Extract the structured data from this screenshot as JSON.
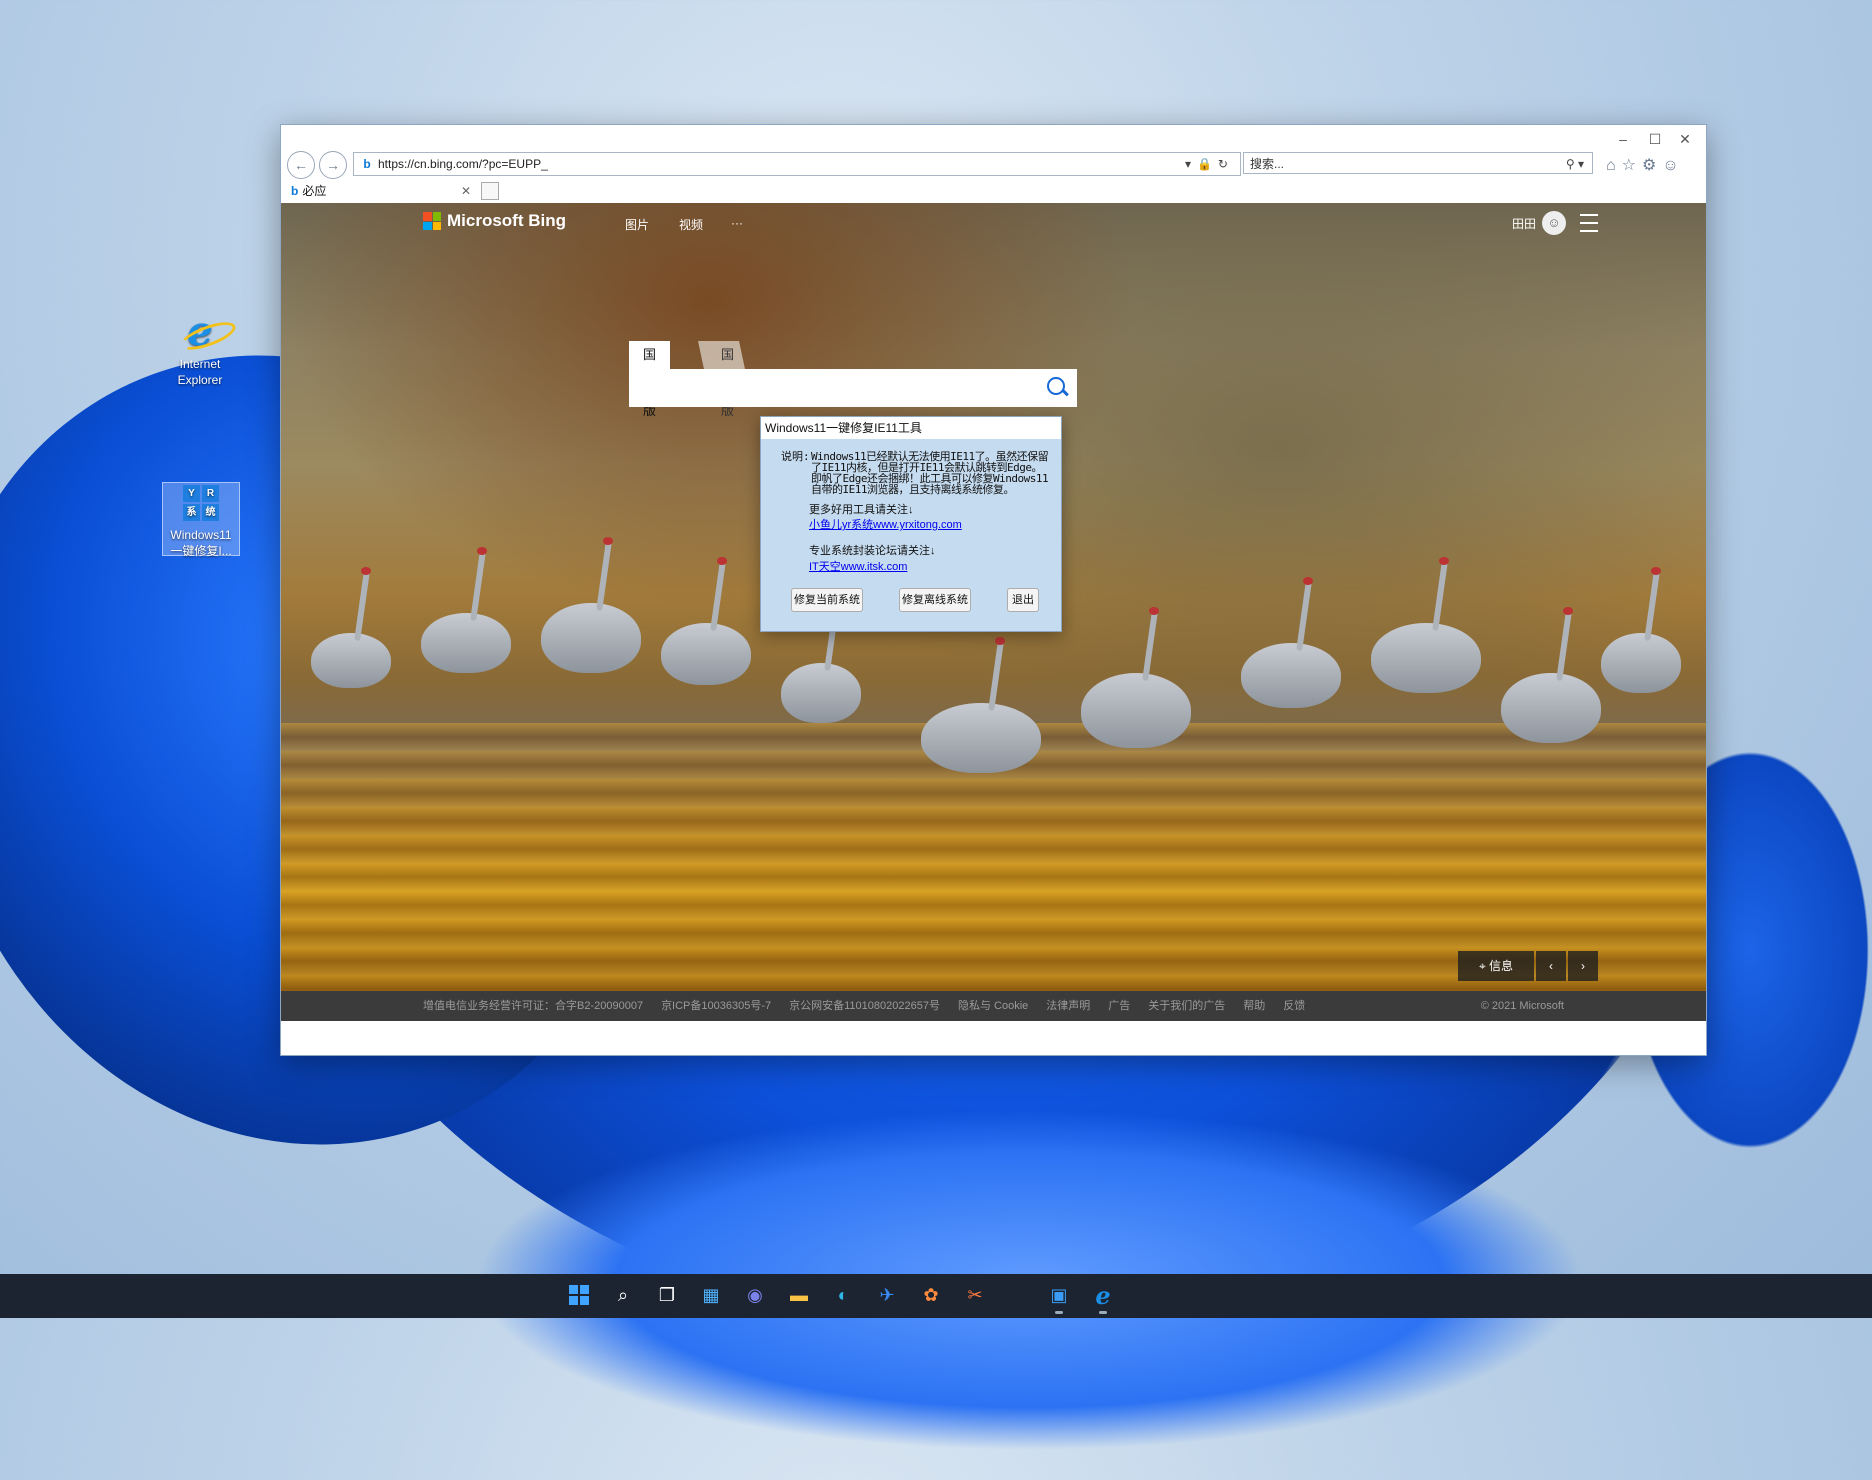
{
  "desktop": {
    "icons": [
      {
        "label_line1": "Internet",
        "label_line2": "Explorer"
      },
      {
        "label_line1": "Windows11",
        "label_line2": "一键修复I..."
      }
    ],
    "tool_icon_glyphs": [
      "Y",
      "R",
      "系",
      "统"
    ]
  },
  "browser": {
    "window_controls": {
      "minimize": "–",
      "maximize": "☐",
      "close": "✕"
    },
    "nav": {
      "back": "←",
      "forward": "→"
    },
    "address": "https://cn.bing.com/?pc=EUPP_",
    "address_tools": "▾🔒↻",
    "search_placeholder": "搜索...",
    "search_icon": "⚲ ▾",
    "right_tools": "⌂☆⚙☺",
    "tab": {
      "title": "必应",
      "close": "✕"
    }
  },
  "bing": {
    "logo_text": "Microsoft Bing",
    "nav": [
      "图片",
      "视频",
      "···"
    ],
    "user_name": "田田",
    "search_tabs": [
      "国内版",
      "国际版"
    ],
    "info_button": "信息",
    "prev": "‹",
    "next": "›",
    "footer_links": [
      "增值电信业务经营许可证：合字B2-20090007",
      "京ICP备10036305号-7",
      "京公网安备11010802022657号",
      "隐私与 Cookie",
      "法律声明",
      "广告",
      "关于我们的广告",
      "帮助",
      "反馈"
    ],
    "copyright": "© 2021 Microsoft"
  },
  "dialog": {
    "title": "Windows11一键修复IE11工具",
    "desc_label": "说明:",
    "desc_text": "Windows11已经默认无法使用IE11了。虽然还保留了IE11内核，但是打开IE11会默认跳转到Edge。即帆了Edge还会捆绑！此工具可以修复Windows11自带的IE11浏览器，且支持离线系统修复。",
    "more_tools": "更多好用工具请关注↓",
    "link1": "小鱼儿yr系统www.yrxitong.com",
    "forum": "专业系统封装论坛请关注↓",
    "link2": "IT天空www.itsk.com",
    "buttons": [
      "修复当前系统",
      "修复离线系统",
      "退出"
    ]
  },
  "taskbar": {
    "icons": [
      "windows-start",
      "search",
      "task-view",
      "widgets",
      "chat",
      "file-explorer",
      "edge",
      "tool-blue",
      "photos",
      "capture",
      "yr-tool",
      "internet-explorer"
    ],
    "glyphs": [
      "",
      "⌕",
      "❐",
      "▦",
      "◉",
      "▬",
      "◐",
      "✈",
      "✿",
      "✂",
      "▣",
      "e"
    ]
  }
}
